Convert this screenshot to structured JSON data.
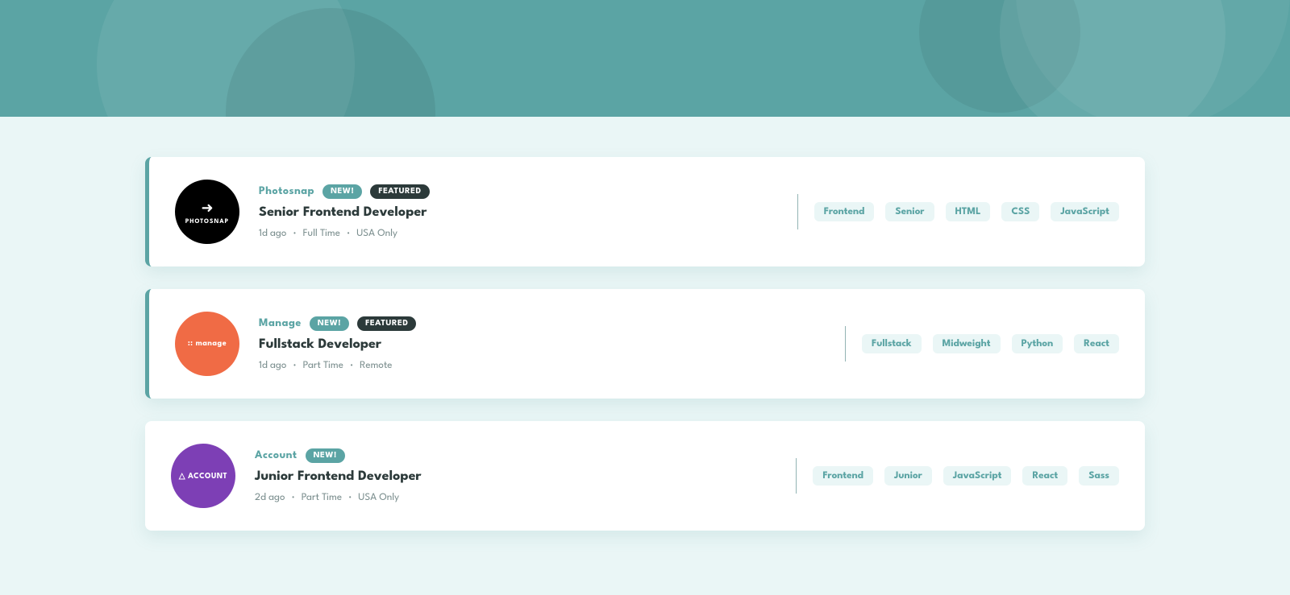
{
  "hero": {
    "background_color": "#5ba4a4"
  },
  "jobs": [
    {
      "id": "job-1",
      "company": "Photosnap",
      "company_logo_type": "photosnap",
      "is_new": true,
      "is_featured": true,
      "title": "Senior Frontend Developer",
      "posted": "1d ago",
      "type": "Full Time",
      "location": "USA Only",
      "tags": [
        "Frontend",
        "Senior",
        "HTML",
        "CSS",
        "JavaScript"
      ]
    },
    {
      "id": "job-2",
      "company": "Manage",
      "company_logo_type": "manage",
      "is_new": true,
      "is_featured": true,
      "title": "Fullstack Developer",
      "posted": "1d ago",
      "type": "Part Time",
      "location": "Remote",
      "tags": [
        "Fullstack",
        "Midweight",
        "Python",
        "React"
      ]
    },
    {
      "id": "job-3",
      "company": "Account",
      "company_logo_type": "account",
      "is_new": true,
      "is_featured": false,
      "title": "Junior Frontend Developer",
      "posted": "2d ago",
      "type": "Part Time",
      "location": "USA Only",
      "tags": [
        "Frontend",
        "Junior",
        "JavaScript",
        "React",
        "Sass"
      ]
    }
  ],
  "badge_labels": {
    "new": "NEW!",
    "featured": "FEATURED"
  }
}
